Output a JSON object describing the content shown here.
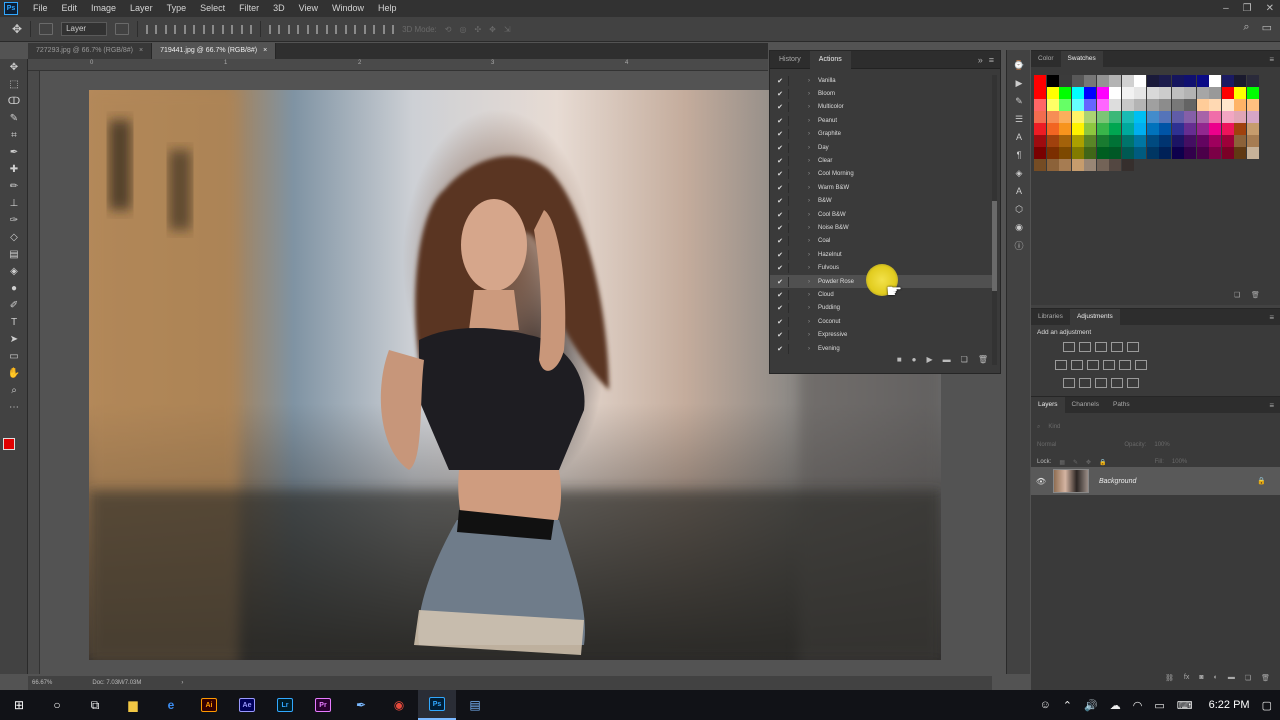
{
  "menu": [
    "File",
    "Edit",
    "Image",
    "Layer",
    "Type",
    "Select",
    "Filter",
    "3D",
    "View",
    "Window",
    "Help"
  ],
  "options": {
    "auto_select": "Layer",
    "mode3d": "3D Mode:"
  },
  "tabs": [
    {
      "label": "727293.jpg @ 66.7% (RGB/8#)"
    },
    {
      "label": "719441.jpg @ 66.7% (RGB/8#)"
    }
  ],
  "ruler": {
    "marks": [
      "0",
      "1",
      "2",
      "3",
      "4"
    ]
  },
  "status": {
    "zoom": "66.67%",
    "doc": "Doc: 7.03M/7.03M"
  },
  "actions_panel": {
    "tabs": [
      "History",
      "Actions"
    ],
    "items": [
      {
        "label": "Vanilla"
      },
      {
        "label": "Bloom"
      },
      {
        "label": "Multicolor"
      },
      {
        "label": "Peanut"
      },
      {
        "label": "Graphite"
      },
      {
        "label": "Day"
      },
      {
        "label": "Clear"
      },
      {
        "label": "Cool Morning"
      },
      {
        "label": "Warm B&W"
      },
      {
        "label": "B&W"
      },
      {
        "label": "Cool B&W"
      },
      {
        "label": "Noise B&W"
      },
      {
        "label": "Coal"
      },
      {
        "label": "Hazelnut"
      },
      {
        "label": "Fulvous"
      },
      {
        "label": "Powder Rose"
      },
      {
        "label": "Cloud"
      },
      {
        "label": "Pudding"
      },
      {
        "label": "Coconut"
      },
      {
        "label": "Expressive"
      },
      {
        "label": "Evening"
      }
    ],
    "selected_index": 15
  },
  "color_panel": {
    "tabs": [
      "Color",
      "Swatches"
    ]
  },
  "swatches": [
    "#ff0000",
    "#000000",
    "#3b3b3b",
    "#585858",
    "#777777",
    "#949494",
    "#b3b3b3",
    "#d1d1d1",
    "#ffffff",
    "#1a1a3a",
    "#1c1c4c",
    "#15155e",
    "#101070",
    "#0b0b86",
    "#ffffff",
    "#1a1a62",
    "#1a1a2e",
    "#2a2a3a",
    "#ff0000",
    "#ffff00",
    "#00ff00",
    "#00ffff",
    "#0000ff",
    "#ff00ff",
    "#ffffff",
    "#f2f2f2",
    "#e6e6e6",
    "#d9d9d9",
    "#cccccc",
    "#bfbfbf",
    "#b3b3b3",
    "#a6a6a6",
    "#999999",
    "#ff0000",
    "#ffff00",
    "#00ff00",
    "#ff6666",
    "#ffff66",
    "#66ff66",
    "#66ffff",
    "#6666ff",
    "#ff66ff",
    "#dddddd",
    "#c8c8c8",
    "#b4b4b4",
    "#a0a0a0",
    "#8c8c8c",
    "#787878",
    "#646464",
    "#ffcc99",
    "#ffd9b3",
    "#ffe6cc",
    "#ffb366",
    "#ffc080",
    "#f26c4f",
    "#f68e55",
    "#fbaf5c",
    "#fff467",
    "#acd372",
    "#7cc576",
    "#3bb878",
    "#1abbb4",
    "#00bff3",
    "#438ccb",
    "#5574b9",
    "#605ca8",
    "#855fa8",
    "#a763a8",
    "#f06ea9",
    "#f2a6c2",
    "#e1a5b6",
    "#d6a6c6",
    "#ed1c24",
    "#f26522",
    "#f7941d",
    "#fff200",
    "#8dc63f",
    "#39b54a",
    "#00a651",
    "#00a99d",
    "#00aeef",
    "#0072bc",
    "#0054a6",
    "#2e3192",
    "#662d91",
    "#92278f",
    "#ec008c",
    "#ed145b",
    "#a0410d",
    "#c69c6d",
    "#9e0b0f",
    "#a0410d",
    "#a3620a",
    "#aba000",
    "#598527",
    "#197b30",
    "#007236",
    "#00746b",
    "#0076a3",
    "#004a80",
    "#003471",
    "#1b1464",
    "#440e62",
    "#630460",
    "#9e005d",
    "#9e0039",
    "#8c6239",
    "#a67c52",
    "#790000",
    "#7b2e00",
    "#7d4900",
    "#827b00",
    "#406618",
    "#005e20",
    "#005826",
    "#005952",
    "#005b7f",
    "#003663",
    "#002157",
    "#0d004c",
    "#32004b",
    "#4b0049",
    "#7b0046",
    "#7a0026",
    "#603913",
    "#c7b299",
    "#754c24",
    "#8c6239",
    "#a67c52",
    "#c69c6d",
    "#998675",
    "#736357",
    "#534741",
    "#362f2d",
    "",
    "",
    "",
    "",
    "",
    "",
    "",
    "",
    "",
    ""
  ],
  "adjustments_panel": {
    "tabs": [
      "Libraries",
      "Adjustments"
    ],
    "title": "Add an adjustment"
  },
  "layers_panel": {
    "tabs": [
      "Layers",
      "Channels",
      "Paths"
    ],
    "kind_label": "Kind",
    "blend": "Normal",
    "opacity_label": "Opacity:",
    "opacity": "100%",
    "lock_label": "Lock:",
    "fill_label": "Fill:",
    "fill": "100%",
    "layers": [
      {
        "name": "Background"
      }
    ]
  },
  "taskbar": {
    "time": "6:22 PM",
    "apps": [
      "Ai",
      "Ae",
      "Lr",
      "Pr",
      "Ps"
    ]
  }
}
